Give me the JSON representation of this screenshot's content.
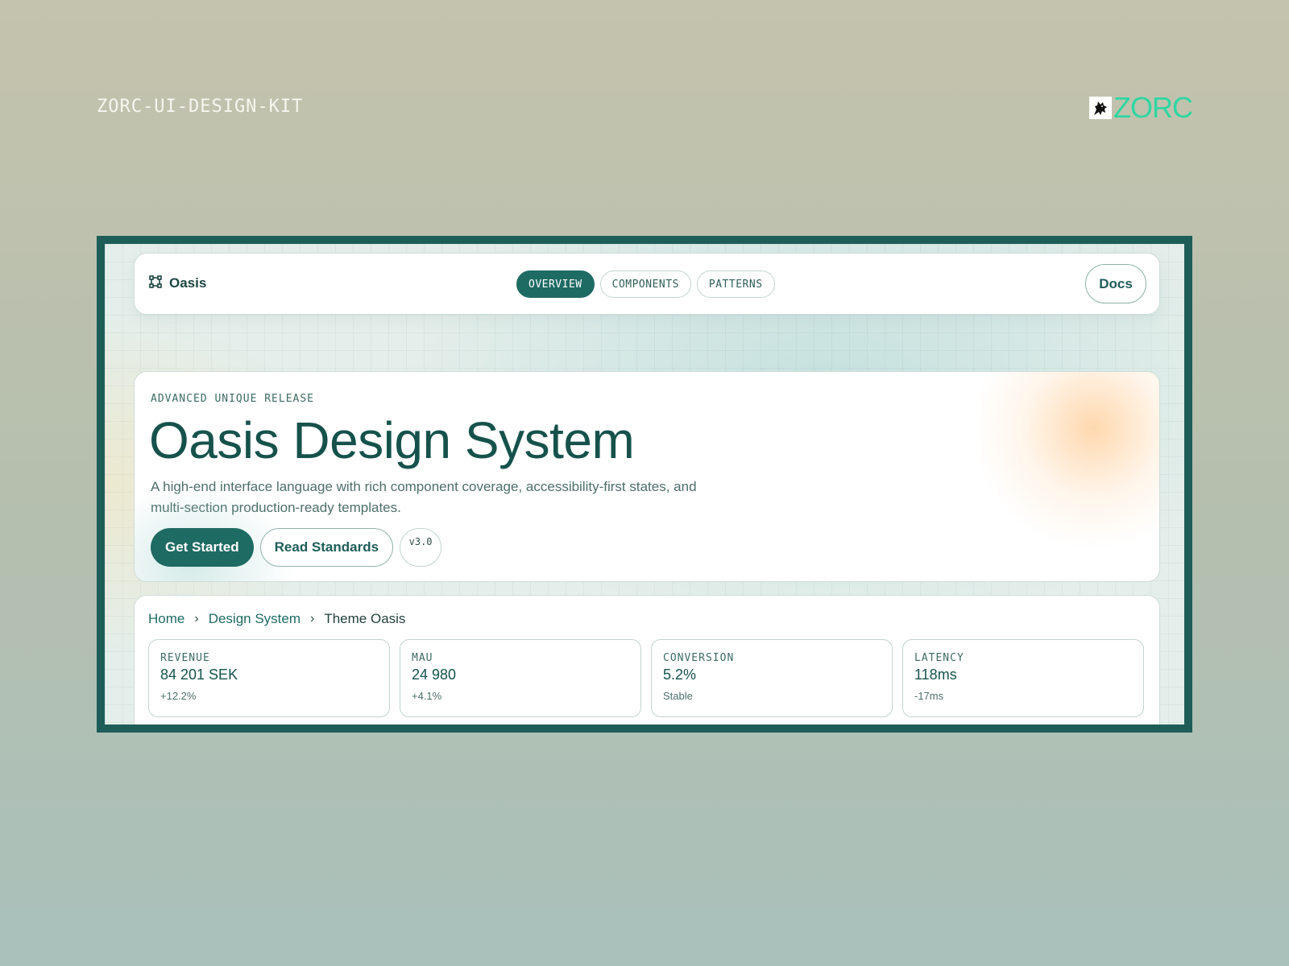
{
  "page": {
    "kit_label": "ZORC-UI-DESIGN-KIT",
    "brand": {
      "name": "ZORC",
      "icon": "wolf-logo-icon",
      "color": "#2fd6a3"
    }
  },
  "nav": {
    "brand_name": "Oasis",
    "brand_icon": "frame-nodes-icon",
    "tabs": [
      {
        "label": "OVERVIEW",
        "active": true
      },
      {
        "label": "COMPONENTS",
        "active": false
      },
      {
        "label": "PATTERNS",
        "active": false
      }
    ],
    "docs_label": "Docs"
  },
  "hero": {
    "eyebrow": "ADVANCED UNIQUE RELEASE",
    "title": "Oasis Design System",
    "description": "A high-end interface language with rich component coverage, accessibility-first states, and multi-section production-ready templates.",
    "primary_cta": "Get Started",
    "secondary_cta": "Read Standards",
    "version": "v3.0"
  },
  "breadcrumb": {
    "items": [
      "Home",
      "Design System",
      "Theme Oasis"
    ],
    "separator": "›"
  },
  "stats": [
    {
      "label": "REVENUE",
      "value": "84 201 SEK",
      "delta": "+12.2%"
    },
    {
      "label": "MAU",
      "value": "24 980",
      "delta": "+4.1%"
    },
    {
      "label": "CONVERSION",
      "value": "5.2%",
      "delta": "Stable"
    },
    {
      "label": "LATENCY",
      "value": "118ms",
      "delta": "-17ms"
    }
  ],
  "colors": {
    "accent": "#1e6b63",
    "frame": "#1e5d58",
    "title": "#16524b"
  }
}
